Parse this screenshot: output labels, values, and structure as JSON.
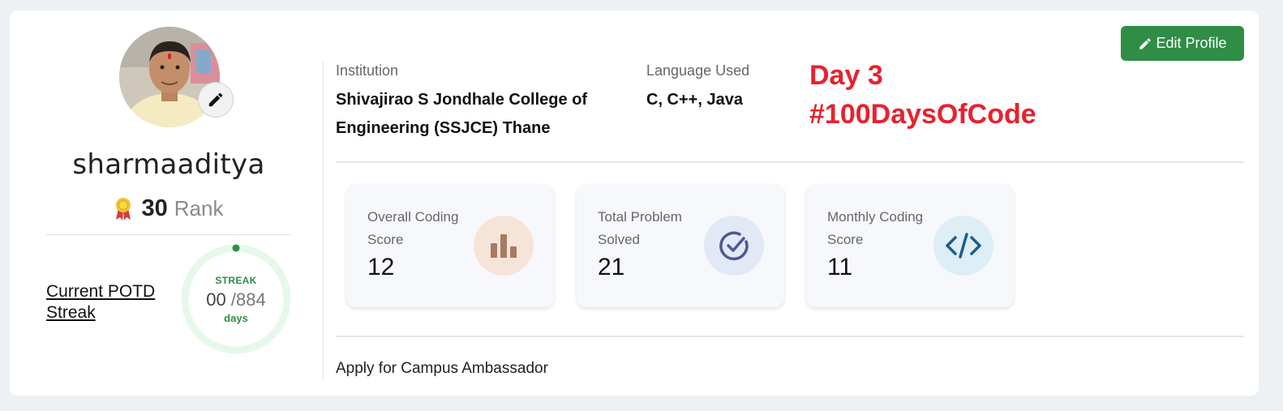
{
  "profile": {
    "username": "sharmaaditya",
    "rank_value": "30",
    "rank_label": "Rank",
    "avatar_icon": "user-photo",
    "edit_avatar_icon": "pencil-icon"
  },
  "streak": {
    "link_label_line1": "Current POTD",
    "link_label_line2": "Streak",
    "label": "STREAK",
    "current": "00",
    "total": "/884",
    "unit": "days"
  },
  "info": {
    "institution_label": "Institution",
    "institution_line1": "Shivajirao S Jondhale College of",
    "institution_line2": "Engineering (SSJCE) Thane",
    "language_label": "Language Used",
    "language_value": "C, C++, Java",
    "overlay_line1": "Day 3",
    "overlay_line2": "#100DaysOfCode"
  },
  "edit_profile": {
    "label": "Edit Profile",
    "icon": "pencil-icon"
  },
  "stats": [
    {
      "label_line1": "Overall Coding",
      "label_line2": "Score",
      "value": "12",
      "icon": "bar-chart-icon"
    },
    {
      "label_line1": "Total Problem",
      "label_line2": "Solved",
      "value": "21",
      "icon": "check-circle-icon"
    },
    {
      "label_line1": "Monthly Coding",
      "label_line2": "Score",
      "value": "11",
      "icon": "code-icon"
    }
  ],
  "ambassador_link": "Apply for Campus Ambassador",
  "colors": {
    "accent_green": "#2f8d46",
    "overlay_red": "#e8212e",
    "background": "#eef1f4"
  }
}
